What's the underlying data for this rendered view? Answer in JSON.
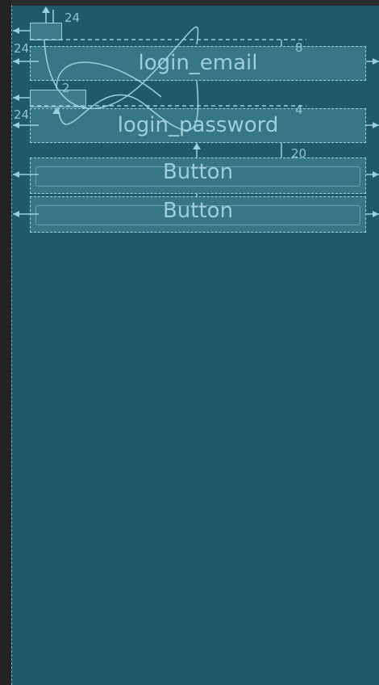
{
  "widgets": {
    "email": {
      "label": "login_email"
    },
    "password": {
      "label": "login_password"
    },
    "button1": {
      "label": "Button"
    },
    "button2": {
      "label": "Button"
    }
  },
  "margins": {
    "top_label_margin": "24",
    "email_left_margin": "24",
    "email_top_margin": "8",
    "password_label_margin": "2",
    "password_left_margin": "24",
    "password_top_margin": "4",
    "button_top_margin": "20"
  },
  "colors": {
    "canvas": "#1f5a6b",
    "outline": "#9ad0dc",
    "text": "#9ccfd9"
  }
}
